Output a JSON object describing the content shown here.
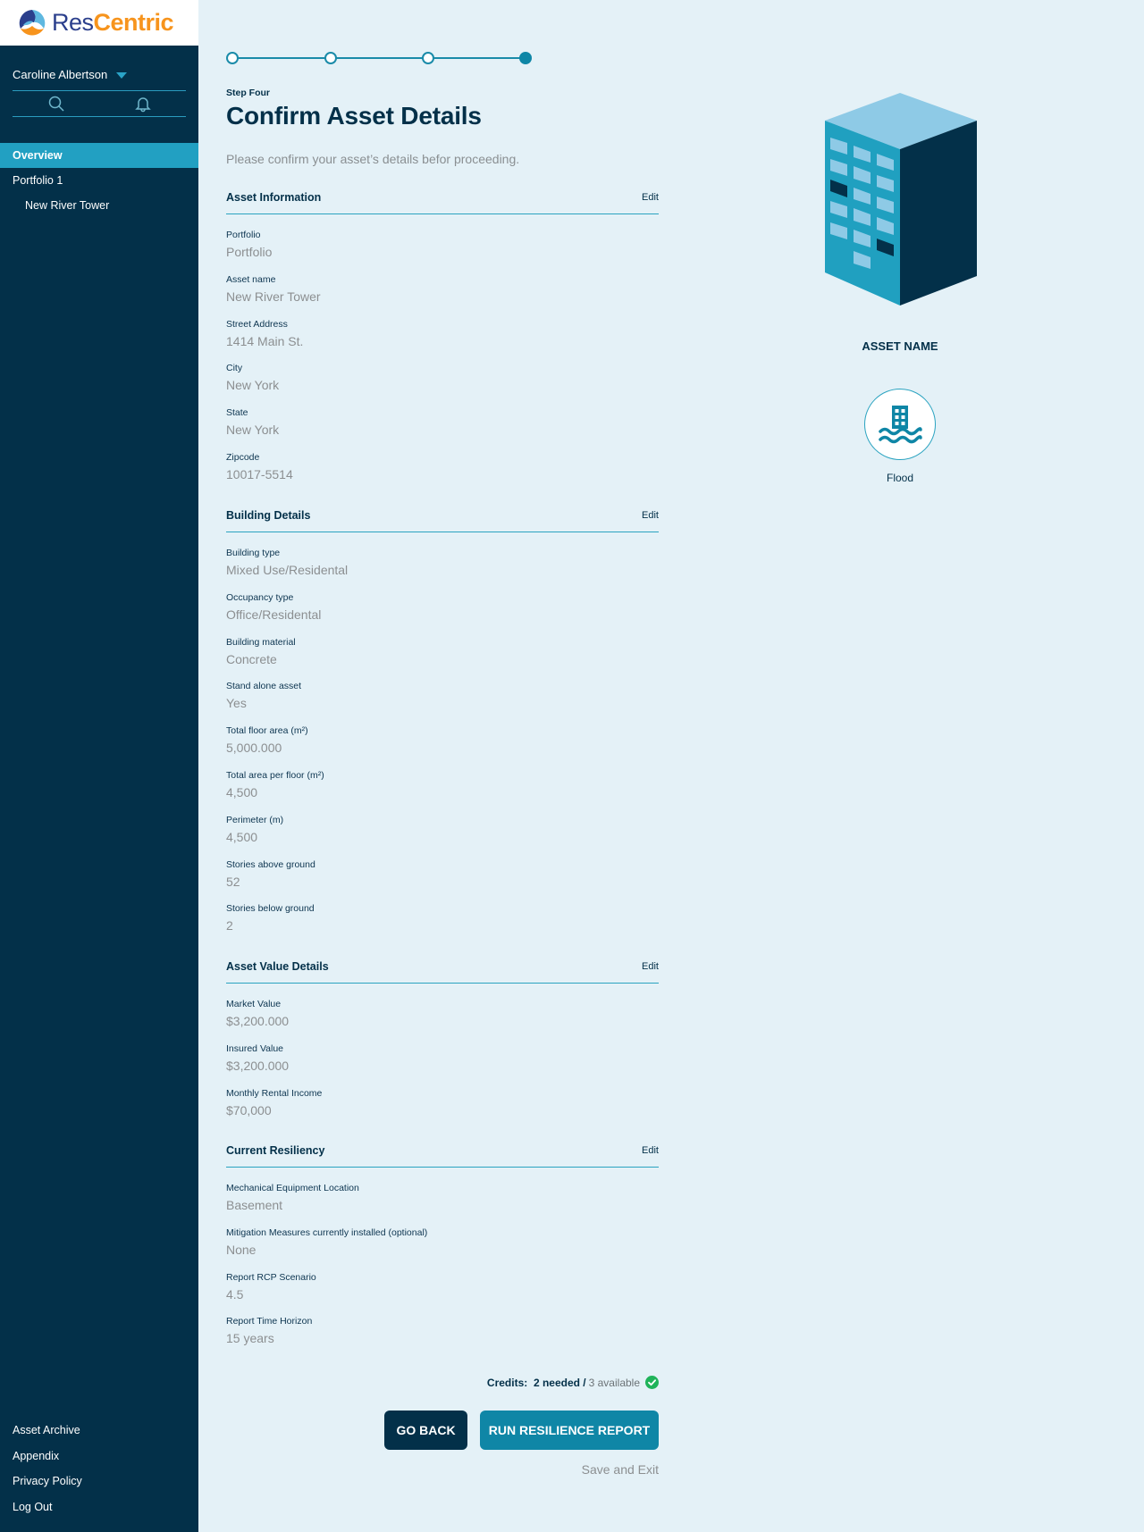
{
  "brand": {
    "name_part1": "Res",
    "name_part2": "Centric",
    "colors": {
      "blue": "#2b3f8c",
      "orange": "#f7941d"
    }
  },
  "sidebar": {
    "user_name": "Caroline Albertson",
    "tools": [
      {
        "icon": "search-icon"
      },
      {
        "icon": "bell-icon"
      }
    ],
    "nav": [
      {
        "label": "Overview",
        "active": true
      },
      {
        "label": "Portfolio 1",
        "active": false
      },
      {
        "label": "New River Tower",
        "active": false,
        "sub": true
      }
    ],
    "footer": [
      {
        "label": "Asset Archive"
      },
      {
        "label": "Appendix"
      },
      {
        "label": "Privacy Policy"
      },
      {
        "label": "Log Out"
      }
    ]
  },
  "stepper": {
    "total_steps": 4,
    "current_step": 4
  },
  "header": {
    "step_label": "Step Four",
    "title": "Confirm Asset Details",
    "subtitle": "Please confirm your asset’s details befor proceeding."
  },
  "sections": [
    {
      "title": "Asset Information",
      "edit_label": "Edit",
      "fields": [
        {
          "label": "Portfolio",
          "value": "Portfolio"
        },
        {
          "label": "Asset name",
          "value": "New River Tower"
        },
        {
          "label": "Street Address",
          "value": "1414 Main St."
        },
        {
          "label": "City",
          "value": "New York"
        },
        {
          "label": "State",
          "value": "New York"
        },
        {
          "label": "Zipcode",
          "value": "10017-5514"
        }
      ]
    },
    {
      "title": "Building Details",
      "edit_label": "Edit",
      "fields": [
        {
          "label": "Building type",
          "value": "Mixed Use/Residental"
        },
        {
          "label": "Occupancy type",
          "value": "Office/Residental"
        },
        {
          "label": "Building material",
          "value": "Concrete"
        },
        {
          "label": "Stand alone asset",
          "value": "Yes"
        },
        {
          "label": "Total floor area (m²)",
          "value": "5,000.000"
        },
        {
          "label": "Total area per floor (m²)",
          "value": "4,500"
        },
        {
          "label": "Perimeter (m)",
          "value": "4,500"
        },
        {
          "label": "Stories above ground",
          "value": "52"
        },
        {
          "label": "Stories below ground",
          "value": "2"
        }
      ]
    },
    {
      "title": "Asset Value Details",
      "edit_label": "Edit",
      "fields": [
        {
          "label": "Market Value",
          "value": "$3,200.000"
        },
        {
          "label": "Insured Value",
          "value": "$3,200.000"
        },
        {
          "label": "Monthly Rental Income",
          "value": "$70,000"
        }
      ]
    },
    {
      "title": "Current Resiliency",
      "edit_label": "Edit",
      "fields": [
        {
          "label": "Mechanical Equipment Location",
          "value": "Basement"
        },
        {
          "label": "Mitigation Measures currently installed (optional)",
          "value": "None"
        },
        {
          "label": "Report RCP Scenario",
          "value": "4.5"
        },
        {
          "label": "Report Time Horizon",
          "value": "15 years"
        }
      ]
    }
  ],
  "credits": {
    "label": "Credits:",
    "needed": "2 needed /",
    "available": "3 available",
    "status_icon": "check-circle-icon",
    "status_color": "#1fb35a"
  },
  "actions": {
    "go_back": "GO BACK",
    "run_report": "RUN RESILIENCE REPORT",
    "save_exit": "Save and Exit"
  },
  "asset_panel": {
    "asset_name": "ASSET NAME",
    "hazard_label": "Flood",
    "hazard_icon": "flood-icon"
  }
}
